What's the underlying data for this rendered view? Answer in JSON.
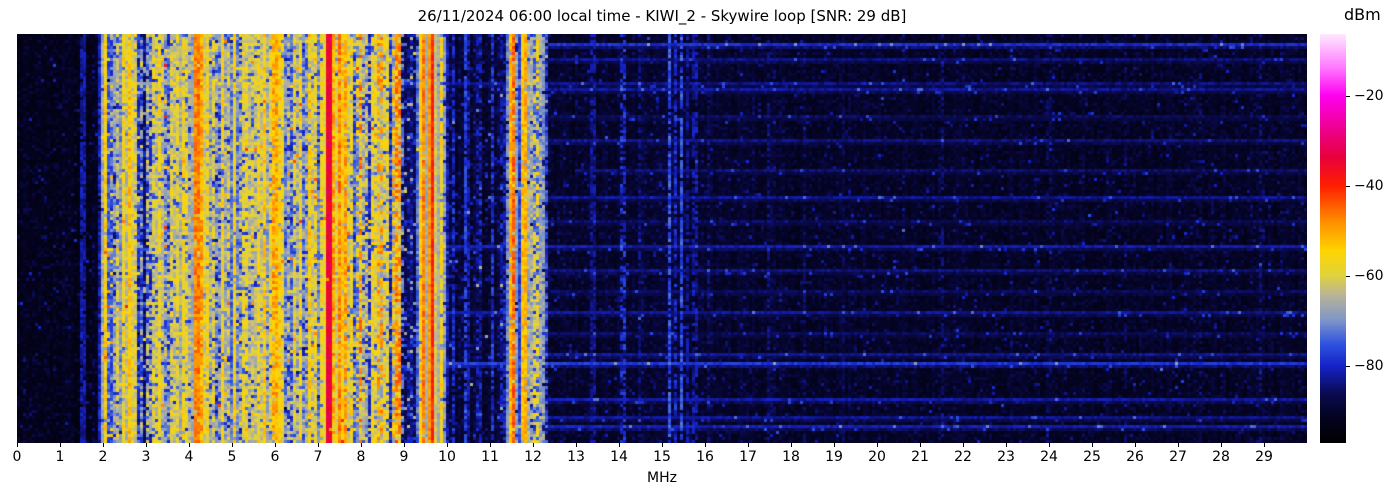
{
  "figure": {
    "title": "26/11/2024 06:00 local time - KIWI_2 - Skywire loop [SNR: 29 dB]",
    "xlabel": "MHz",
    "colorbar_label": "dBm"
  },
  "chart_data": {
    "type": "heatmap",
    "subtype": "radio-spectrum-waterfall",
    "title": "26/11/2024 06:00 local time - KIWI_2 - Skywire loop [SNR: 29 dB]",
    "station": "KIWI_2",
    "antenna": "Skywire loop",
    "snr_db": 29,
    "datetime_local": "26/11/2024 06:00",
    "xlabel": "MHz",
    "x_range": [
      0,
      30
    ],
    "x_tick_labels": [
      "0",
      "1",
      "2",
      "3",
      "4",
      "5",
      "6",
      "7",
      "8",
      "9",
      "10",
      "11",
      "12",
      "13",
      "14",
      "15",
      "16",
      "17",
      "18",
      "19",
      "20",
      "21",
      "22",
      "23",
      "24",
      "25",
      "26",
      "27",
      "28",
      "29"
    ],
    "y_axis": "time (waterfall, no tick labels shown)",
    "grid": false,
    "colorbar": {
      "label": "dBm",
      "vmin": -97,
      "vmax": -6,
      "ticks": [
        {
          "value": -20,
          "label": "−20"
        },
        {
          "value": -40,
          "label": "−40"
        },
        {
          "value": -60,
          "label": "−60"
        },
        {
          "value": -80,
          "label": "−80"
        }
      ]
    },
    "colormap_stops": [
      [
        0.0,
        "#000000"
      ],
      [
        0.06,
        "#04031f"
      ],
      [
        0.12,
        "#0a0a50"
      ],
      [
        0.187,
        "#1522c8"
      ],
      [
        0.24,
        "#2e52e0"
      ],
      [
        0.3,
        "#7f96c8"
      ],
      [
        0.36,
        "#b8b49a"
      ],
      [
        0.41,
        "#e0d33c"
      ],
      [
        0.47,
        "#ffd400"
      ],
      [
        0.54,
        "#ff9000"
      ],
      [
        0.6,
        "#ff4400"
      ],
      [
        0.63,
        "#ff1e00"
      ],
      [
        0.7,
        "#e8003c"
      ],
      [
        0.77,
        "#ee0090"
      ],
      [
        0.85,
        "#ff00f0"
      ],
      [
        0.92,
        "#ff7bff"
      ],
      [
        1.0,
        "#ffe8ff"
      ]
    ],
    "noise_floor_regions": [
      {
        "f": [
          0.0,
          1.98
        ],
        "base": -93.5,
        "jitter": 3.5,
        "speckle_p": 0.0,
        "col_var": 1.2
      },
      {
        "f": [
          1.98,
          2.92
        ],
        "base": -84.0,
        "jitter": 6.5,
        "speckle_p": 0.2,
        "col_var": 5.0
      },
      {
        "f": [
          2.92,
          3.18
        ],
        "base": -87.0,
        "jitter": 5.0,
        "speckle_p": 0.08,
        "col_var": 3.0
      },
      {
        "f": [
          3.18,
          8.72
        ],
        "base": -84.0,
        "jitter": 6.5,
        "speckle_p": 0.2,
        "col_var": 5.0
      },
      {
        "f": [
          8.72,
          9.95
        ],
        "base": -88.0,
        "jitter": 5.0,
        "speckle_p": 0.06,
        "col_var": 3.0
      },
      {
        "f": [
          9.95,
          11.45
        ],
        "base": -90.5,
        "jitter": 4.0,
        "speckle_p": 0.01,
        "col_var": 2.0
      },
      {
        "f": [
          11.45,
          12.35
        ],
        "base": -87.5,
        "jitter": 5.0,
        "speckle_p": 0.04,
        "col_var": 3.0
      },
      {
        "f": [
          12.35,
          30.0
        ],
        "base": -91.5,
        "jitter": 3.2,
        "speckle_p": 0.0,
        "col_var": 1.2,
        "slope_db_per_mhz": -0.05
      }
    ],
    "signals": [
      {
        "f": 1.53,
        "hw": 0.015,
        "dbm": -82,
        "var": 3,
        "duty": 0.9
      },
      {
        "f": 2.05,
        "hw": 0.018,
        "dbm": -55,
        "var": 4,
        "duty": 0.97
      },
      {
        "f": 2.18,
        "hw": 0.02,
        "dbm": -76,
        "var": 5,
        "duty": 0.9
      },
      {
        "f": 2.32,
        "hw": 0.02,
        "dbm": -62,
        "var": 5,
        "duty": 0.8
      },
      {
        "f": 2.47,
        "hw": 0.025,
        "dbm": -57,
        "var": 5,
        "duty": 0.95
      },
      {
        "f": 2.62,
        "hw": 0.04,
        "dbm": -53,
        "var": 5,
        "duty": 0.97
      },
      {
        "f": 2.74,
        "hw": 0.02,
        "dbm": -60,
        "var": 5,
        "duty": 0.85
      },
      {
        "f": 2.88,
        "hw": 0.02,
        "dbm": -73,
        "var": 6,
        "duty": 0.8
      },
      {
        "f": 3.06,
        "hw": 0.018,
        "dbm": -64,
        "var": 6,
        "duty": 0.6
      },
      {
        "f": 3.2,
        "hw": 0.02,
        "dbm": -60,
        "var": 5,
        "duty": 0.85
      },
      {
        "f": 3.33,
        "hw": 0.022,
        "dbm": -57,
        "var": 5,
        "duty": 0.9
      },
      {
        "f": 3.49,
        "hw": 0.02,
        "dbm": -70,
        "var": 6,
        "duty": 0.7
      },
      {
        "f": 3.62,
        "hw": 0.02,
        "dbm": -61,
        "var": 5,
        "duty": 0.85
      },
      {
        "f": 3.74,
        "hw": 0.02,
        "dbm": -59,
        "var": 5,
        "duty": 0.9
      },
      {
        "f": 3.86,
        "hw": 0.022,
        "dbm": -57,
        "var": 5,
        "duty": 0.9
      },
      {
        "f": 3.96,
        "hw": 0.018,
        "dbm": -60,
        "var": 5,
        "duty": 0.85
      },
      {
        "f": 4.2,
        "hw": 0.045,
        "dbm": -46,
        "var": 4,
        "duty": 0.98
      },
      {
        "f": 4.3,
        "hw": 0.025,
        "dbm": -50,
        "var": 5,
        "duty": 0.95
      },
      {
        "f": 4.42,
        "hw": 0.02,
        "dbm": -57,
        "var": 5,
        "duty": 0.9
      },
      {
        "f": 4.55,
        "hw": 0.02,
        "dbm": -61,
        "var": 6,
        "duty": 0.8
      },
      {
        "f": 4.67,
        "hw": 0.018,
        "dbm": -68,
        "var": 6,
        "duty": 0.7
      },
      {
        "f": 4.79,
        "hw": 0.02,
        "dbm": -57,
        "var": 5,
        "duty": 0.9
      },
      {
        "f": 4.92,
        "hw": 0.018,
        "dbm": -62,
        "var": 6,
        "duty": 0.8
      },
      {
        "f": 5.06,
        "hw": 0.02,
        "dbm": -56,
        "var": 5,
        "duty": 0.92
      },
      {
        "f": 5.19,
        "hw": 0.02,
        "dbm": -66,
        "var": 6,
        "duty": 0.7
      },
      {
        "f": 5.31,
        "hw": 0.02,
        "dbm": -59,
        "var": 5,
        "duty": 0.85
      },
      {
        "f": 5.45,
        "hw": 0.02,
        "dbm": -62,
        "var": 6,
        "duty": 0.8
      },
      {
        "f": 5.6,
        "hw": 0.022,
        "dbm": -57,
        "var": 5,
        "duty": 0.9
      },
      {
        "f": 5.74,
        "hw": 0.022,
        "dbm": -55,
        "var": 5,
        "duty": 0.92
      },
      {
        "f": 5.88,
        "hw": 0.02,
        "dbm": -59,
        "var": 5,
        "duty": 0.85
      },
      {
        "f": 6.0,
        "hw": 0.025,
        "dbm": -51,
        "var": 5,
        "duty": 0.95
      },
      {
        "f": 6.08,
        "hw": 0.02,
        "dbm": -55,
        "var": 5,
        "duty": 0.9
      },
      {
        "f": 6.18,
        "hw": 0.02,
        "dbm": -58,
        "var": 5,
        "duty": 0.85
      },
      {
        "f": 6.31,
        "hw": 0.02,
        "dbm": -65,
        "var": 6,
        "duty": 0.7
      },
      {
        "f": 6.45,
        "hw": 0.02,
        "dbm": -61,
        "var": 5,
        "duty": 0.8
      },
      {
        "f": 6.58,
        "hw": 0.022,
        "dbm": -57,
        "var": 5,
        "duty": 0.9
      },
      {
        "f": 6.71,
        "hw": 0.02,
        "dbm": -66,
        "var": 6,
        "duty": 0.7
      },
      {
        "f": 6.82,
        "hw": 0.02,
        "dbm": -55,
        "var": 5,
        "duty": 0.9
      },
      {
        "f": 6.95,
        "hw": 0.02,
        "dbm": -59,
        "var": 5,
        "duty": 0.85
      },
      {
        "f": 7.1,
        "hw": 0.02,
        "dbm": -57,
        "var": 5,
        "duty": 0.88
      },
      {
        "f": 7.26,
        "hw": 0.016,
        "dbm": -33,
        "var": 3,
        "duty": 0.99
      },
      {
        "f": 7.35,
        "hw": 0.02,
        "dbm": -50,
        "var": 5,
        "duty": 0.9
      },
      {
        "f": 7.5,
        "hw": 0.03,
        "dbm": -48,
        "var": 5,
        "duty": 0.95
      },
      {
        "f": 7.62,
        "hw": 0.025,
        "dbm": -50,
        "var": 5,
        "duty": 0.9
      },
      {
        "f": 7.76,
        "hw": 0.02,
        "dbm": -57,
        "var": 5,
        "duty": 0.85
      },
      {
        "f": 7.98,
        "hw": 0.014,
        "dbm": -45,
        "var": 4,
        "duty": 0.4
      },
      {
        "f": 8.1,
        "hw": 0.02,
        "dbm": -63,
        "var": 6,
        "duty": 0.7
      },
      {
        "f": 8.3,
        "hw": 0.022,
        "dbm": -58,
        "var": 5,
        "duty": 0.85
      },
      {
        "f": 8.44,
        "hw": 0.016,
        "dbm": -50,
        "var": 5,
        "duty": 0.5
      },
      {
        "f": 8.58,
        "hw": 0.02,
        "dbm": -59,
        "var": 5,
        "duty": 0.8
      },
      {
        "f": 8.8,
        "hw": 0.016,
        "dbm": -51,
        "var": 5,
        "duty": 0.5
      },
      {
        "f": 8.86,
        "hw": 0.012,
        "dbm": -46,
        "var": 4,
        "duty": 0.5
      },
      {
        "f": 9.44,
        "hw": 0.02,
        "dbm": -47,
        "var": 4,
        "duty": 0.96
      },
      {
        "f": 9.65,
        "hw": 0.016,
        "dbm": -40,
        "var": 3,
        "duty": 0.99
      },
      {
        "f": 9.88,
        "hw": 0.018,
        "dbm": -56,
        "var": 4,
        "duty": 0.9
      },
      {
        "f": 10.15,
        "hw": 0.012,
        "dbm": -80,
        "var": 4,
        "duty": 0.8
      },
      {
        "f": 10.45,
        "hw": 0.012,
        "dbm": -78,
        "var": 4,
        "duty": 0.8
      },
      {
        "f": 10.75,
        "hw": 0.012,
        "dbm": -82,
        "var": 4,
        "duty": 0.7
      },
      {
        "f": 11.05,
        "hw": 0.012,
        "dbm": -79,
        "var": 4,
        "duty": 0.8
      },
      {
        "f": 11.3,
        "hw": 0.012,
        "dbm": -81,
        "var": 4,
        "duty": 0.7
      },
      {
        "f": 11.53,
        "hw": 0.012,
        "dbm": -45,
        "var": 4,
        "duty": 0.9
      },
      {
        "f": 11.8,
        "hw": 0.018,
        "dbm": -51,
        "var": 4,
        "duty": 0.95
      },
      {
        "f": 11.93,
        "hw": 0.03,
        "dbm": -66,
        "var": 5,
        "duty": 0.9
      },
      {
        "f": 12.08,
        "hw": 0.016,
        "dbm": -58,
        "var": 5,
        "duty": 0.6
      },
      {
        "f": 12.2,
        "hw": 0.03,
        "dbm": -67,
        "var": 5,
        "duty": 0.9
      },
      {
        "f": 12.32,
        "hw": 0.014,
        "dbm": -77,
        "var": 5,
        "duty": 0.7
      },
      {
        "f": 13.4,
        "hw": 0.013,
        "dbm": -83,
        "var": 3,
        "duty": 0.8
      },
      {
        "f": 14.1,
        "hw": 0.014,
        "dbm": -79,
        "var": 4,
        "duty": 0.6
      },
      {
        "f": 14.5,
        "hw": 0.012,
        "dbm": -85,
        "var": 3,
        "duty": 0.7
      },
      {
        "f": 15.18,
        "hw": 0.015,
        "dbm": -76,
        "var": 4,
        "duty": 0.85
      },
      {
        "f": 15.3,
        "hw": 0.013,
        "dbm": -80,
        "var": 4,
        "duty": 0.7
      },
      {
        "f": 15.45,
        "hw": 0.015,
        "dbm": -76,
        "var": 4,
        "duty": 0.85
      },
      {
        "f": 15.6,
        "hw": 0.012,
        "dbm": -83,
        "var": 3,
        "duty": 0.7
      },
      {
        "f": 15.77,
        "hw": 0.012,
        "dbm": -82,
        "var": 3,
        "duty": 0.7
      },
      {
        "f": 16.1,
        "hw": 0.012,
        "dbm": -85,
        "var": 3,
        "duty": 0.6
      },
      {
        "f": 17.5,
        "hw": 0.012,
        "dbm": -85,
        "var": 3,
        "duty": 0.6
      },
      {
        "f": 18.3,
        "hw": 0.012,
        "dbm": -86,
        "var": 3,
        "duty": 0.5
      },
      {
        "f": 19.2,
        "hw": 0.012,
        "dbm": -87,
        "var": 3,
        "duty": 0.5
      },
      {
        "f": 21.5,
        "hw": 0.012,
        "dbm": -85,
        "var": 3,
        "duty": 0.6
      },
      {
        "f": 24.0,
        "hw": 0.012,
        "dbm": -87,
        "var": 3,
        "duty": 0.5
      },
      {
        "f": 25.8,
        "hw": 0.012,
        "dbm": -87,
        "var": 3,
        "duty": 0.5
      },
      {
        "f": 27.5,
        "hw": 0.012,
        "dbm": -86,
        "var": 3,
        "duty": 0.5
      },
      {
        "f": 28.9,
        "hw": 0.012,
        "dbm": -86,
        "var": 3,
        "duty": 0.5
      }
    ],
    "time_events": [
      {
        "t": 0.022,
        "boost": 11,
        "f": [
          12.35,
          30
        ]
      },
      {
        "t": 0.06,
        "boost": 6,
        "f": [
          12.35,
          30
        ]
      },
      {
        "t": 0.115,
        "boost": 16,
        "f": [
          2.0,
          9.0
        ]
      },
      {
        "t": 0.115,
        "boost": 6,
        "f": [
          9.0,
          30
        ]
      },
      {
        "t": 0.135,
        "boost": 7,
        "f": [
          12.35,
          30
        ]
      },
      {
        "t": 0.2,
        "boost": 4,
        "f": [
          12.35,
          30
        ]
      },
      {
        "t": 0.26,
        "boost": 6,
        "f": [
          12.35,
          30
        ]
      },
      {
        "t": 0.33,
        "boost": 5,
        "f": [
          13.0,
          30
        ]
      },
      {
        "t": 0.4,
        "boost": 7,
        "f": [
          12.35,
          30
        ]
      },
      {
        "t": 0.455,
        "boost": 4,
        "f": [
          12.35,
          30
        ]
      },
      {
        "t": 0.515,
        "boost": 8,
        "f": [
          9.95,
          30
        ]
      },
      {
        "t": 0.57,
        "boost": 6,
        "f": [
          12.35,
          30
        ]
      },
      {
        "t": 0.625,
        "boost": 4,
        "f": [
          12.35,
          30
        ]
      },
      {
        "t": 0.675,
        "boost": 7,
        "f": [
          9.95,
          30
        ]
      },
      {
        "t": 0.73,
        "boost": 4,
        "f": [
          12.35,
          30
        ]
      },
      {
        "t": 0.78,
        "boost": 7,
        "f": [
          12.35,
          30
        ]
      },
      {
        "t": 0.805,
        "boost": 12,
        "f": [
          9.95,
          30
        ]
      },
      {
        "t": 0.89,
        "boost": 8,
        "f": [
          12.35,
          30
        ]
      },
      {
        "t": 0.935,
        "boost": 7,
        "f": [
          12.35,
          30
        ]
      },
      {
        "t": 0.957,
        "boost": 9,
        "f": [
          12.35,
          30
        ]
      }
    ]
  },
  "render": {
    "seed": 1337,
    "cols": 430,
    "rows": 136
  }
}
